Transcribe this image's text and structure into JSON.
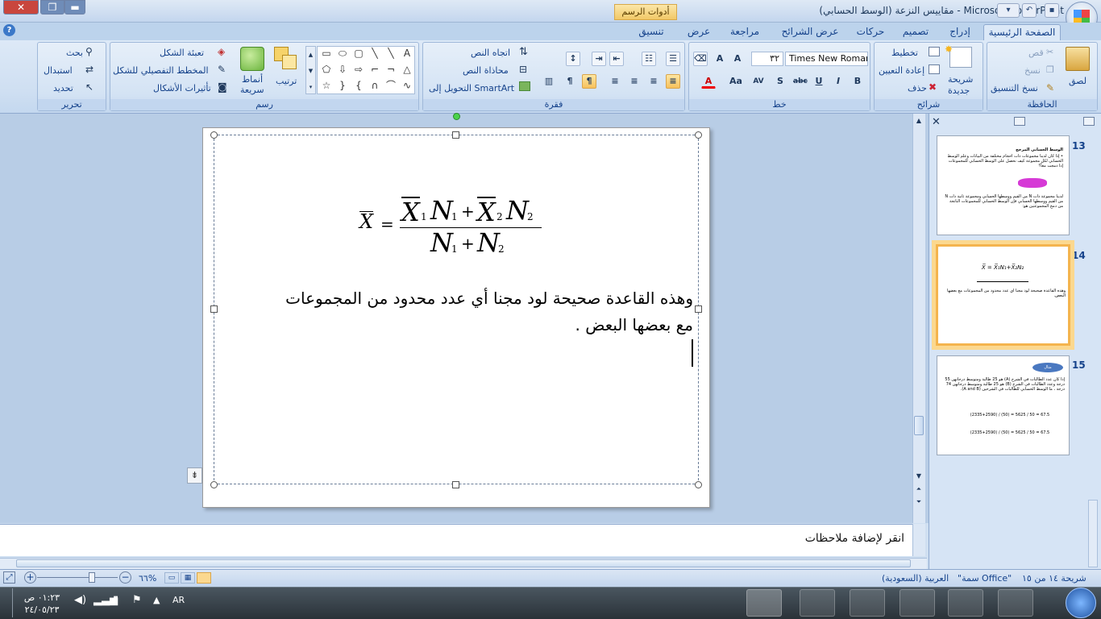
{
  "window": {
    "title": "مقاييس النزعة (الوسط الحسابي) - Microsoft PowerPoint",
    "context_tab": "أدوات الرسم"
  },
  "tabs": [
    "الصفحة الرئيسية",
    "إدراج",
    "تصميم",
    "حركات",
    "عرض الشرائح",
    "مراجعة",
    "عرض",
    "تنسيق"
  ],
  "ribbon": {
    "clipboard": {
      "label": "الحافظة",
      "paste": "لصق",
      "cut": "قص",
      "copy": "نسخ",
      "format_painter": "نسخ التنسيق"
    },
    "slides": {
      "label": "شرائح",
      "new_slide": "شريحة",
      "new_slide2": "جديدة",
      "layout": "تخطيط",
      "reset": "إعادة التعيين",
      "delete": "حذف"
    },
    "font": {
      "label": "خط",
      "name": "Times New Roman",
      "size": "٣٢"
    },
    "paragraph": {
      "label": "فقرة",
      "text_direction": "اتجاه النص",
      "align_text": "محاذاة النص",
      "smartart": "التحويل إلى SmartArt"
    },
    "drawing": {
      "label": "رسم",
      "arrange": "ترتيب",
      "quick_styles": "أنماط",
      "quick_styles2": "سريعة",
      "shape_fill": "تعبئة الشكل",
      "shape_outline": "المخطط التفصيلي للشكل",
      "shape_effects": "تأثيرات الأشكال"
    },
    "editing": {
      "label": "تحرير",
      "find": "بحث",
      "replace": "استبدال",
      "select": "تحديد"
    }
  },
  "slide": {
    "formula": {
      "lhs": "X",
      "n": "N",
      "sub1": "1",
      "sub2": "2",
      "plus": "+",
      "eq": "="
    },
    "body_line1": "وهذه القاعدة صحيحة لود مجنا أي عدد محدود من المجموعات",
    "body_line2": "مع بعضها البعض ."
  },
  "thumbnails": [
    {
      "number": "13",
      "line1": "الوسط الحسابي المرجح",
      "line2": "• إذا كان لدينا مجموعات ذات أحجام مختلفة من البيانات وعلم الوسط الحسابي لكل مجموعة كيف نحصل على الوسط الحسابي للمجموعات إذا دمجت معاً؟",
      "line3": "لدينا مجموعة ذات N من القيم ووسطها الحسابي ومجموعة ثانية ذات N من القيم ووسطها الحسابي فإن الوسط الحسابي للمجموعات الناتجة من دمج المجموعتين هو:"
    },
    {
      "number": "14",
      "line1": "وهذه القاعدة صحيحة لود مجنا أي عدد محدود من المجموعات مع بعضها البعض."
    },
    {
      "number": "15",
      "line1": "مثال",
      "line2": "إذا كان عدد الطالبات في الشرح (A) هو 25 طالبة ومتوسط درجاتهن 55 درجة وعدد الطالبات في الشرح (B) هو 25 طالبة ومتوسط درجاتهن 74 درجة ، ما الوسط الحسابي للطالبات في الشرحين (A and B).",
      "line3": "(2335+2590) / (50) = 5625 / 50 = 67.5"
    }
  ],
  "notes_placeholder": "انقر لإضافة ملاحظات",
  "status": {
    "slide_info": "شريحة ١٤ من ١٥",
    "theme": "\"سمة Office\"",
    "language": "العربية (السعودية)",
    "zoom": "٦٦%"
  },
  "taskbar": {
    "lang": "AR",
    "time": "٠١:٢٣ ص",
    "date": "٢٤/٠٥/٢٣"
  }
}
